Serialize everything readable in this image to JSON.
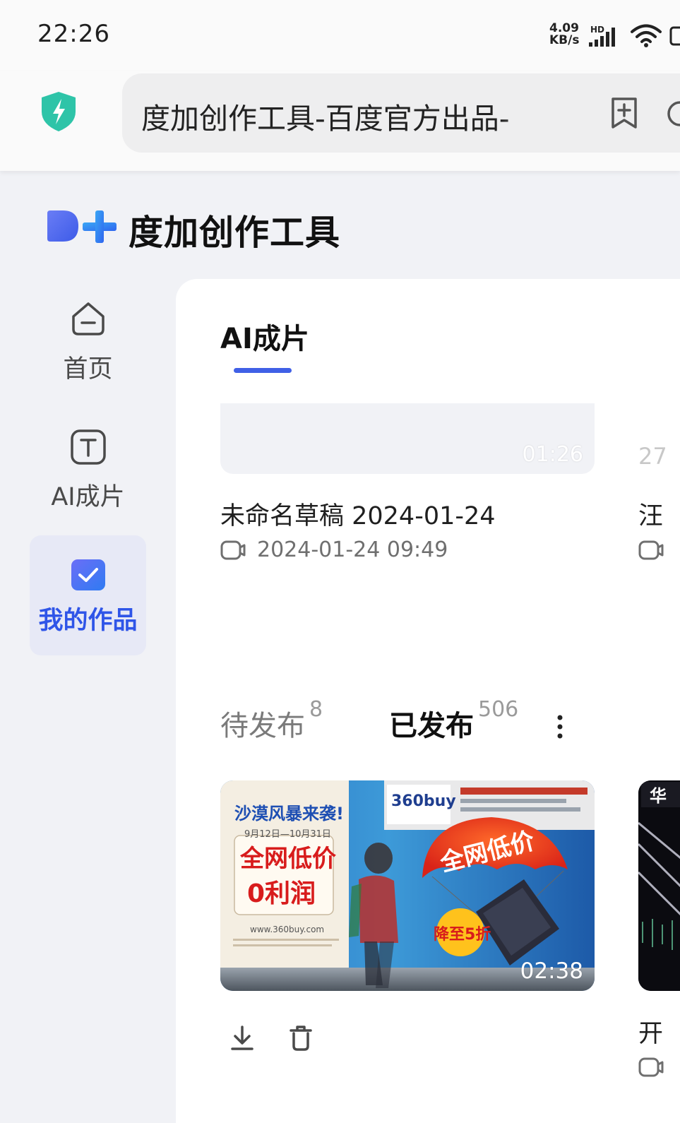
{
  "status_bar": {
    "time": "22:26",
    "net_speed_value": "4.09",
    "net_speed_unit": "KB/s",
    "network_badge": "HD"
  },
  "address_bar": {
    "url_text": "度加创作工具-百度官方出品-"
  },
  "brand": {
    "name": "度加创作工具",
    "accent_color": "#3e6af2"
  },
  "sidebar": {
    "items": [
      {
        "label": "首页",
        "icon": "home-icon"
      },
      {
        "label": "AI成片",
        "icon": "text-t-icon"
      },
      {
        "label": "我的作品",
        "icon": "check-box-icon"
      }
    ],
    "active_index": 2
  },
  "main": {
    "section_tab": "AI成片",
    "draft": {
      "duration": "01:26",
      "title": "未命名草稿 2024-01-24",
      "date": "2024-01-24 09:49"
    },
    "draft_peek": {
      "duration_fragment": "27",
      "title_fragment": "汪"
    },
    "publish_tabs": {
      "pending_label": "待发布",
      "pending_count": "8",
      "published_label": "已发布",
      "published_count": "506"
    },
    "video": {
      "duration": "02:38",
      "poster_headline": "沙漠风暴来袭!",
      "poster_dates": "9月12日—10月31日",
      "poster_line1": "全网低价",
      "poster_line2": "0利润",
      "poster_url": "www.360buy.com",
      "billboard_logo": "360buy",
      "billboard_slogan": "全网低价",
      "badge_text": "降至5折"
    },
    "video_peek": {
      "title_fragment": "开",
      "poster_fragment": "华"
    }
  }
}
